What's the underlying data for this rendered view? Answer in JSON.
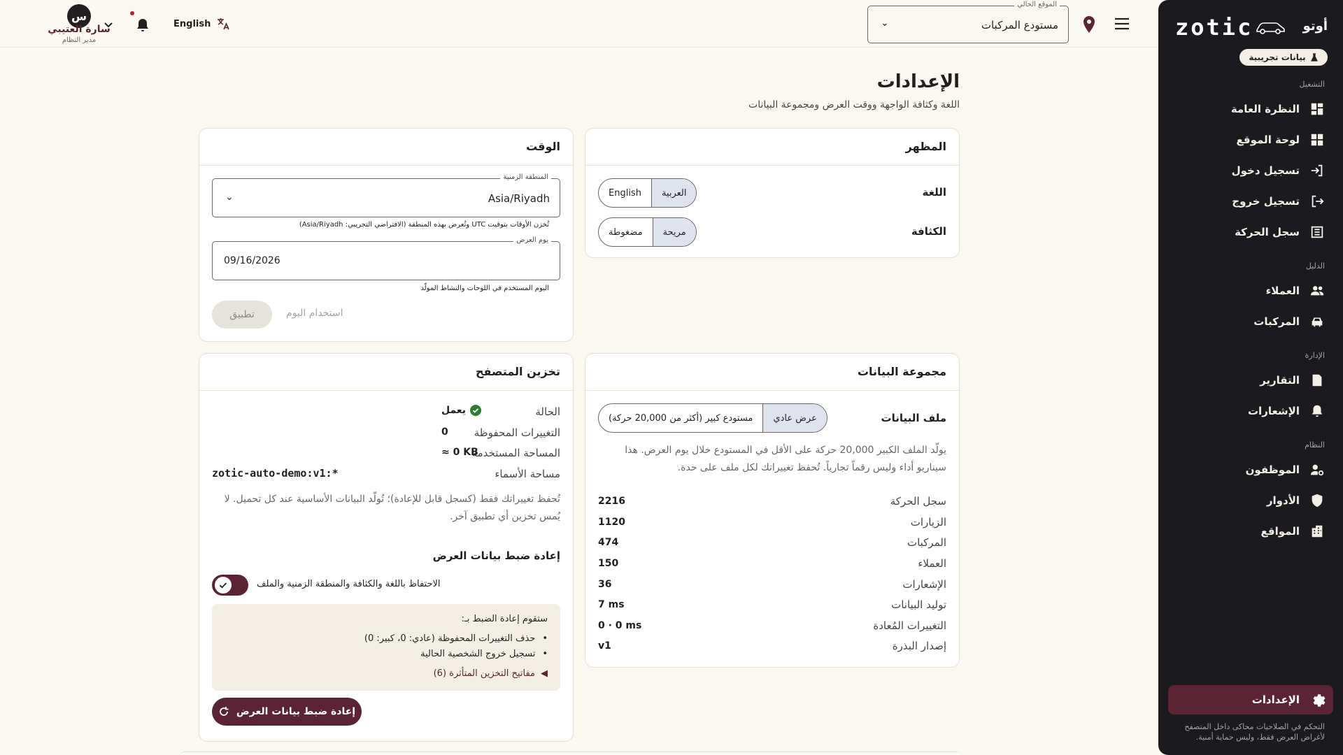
{
  "sidebar": {
    "brand_name": "أوتو",
    "logo_text": "zotic",
    "demo_badge": "بيانات تجريبية",
    "sections": {
      "operation": "التشغيل",
      "directory": "الدليل",
      "management": "الإدارة",
      "system": "النظام"
    },
    "items": [
      {
        "label": "النظرة العامة",
        "icon": "dashboard-icon"
      },
      {
        "label": "لوحة الموقع",
        "icon": "grid-icon"
      },
      {
        "label": "تسجيل دخول",
        "icon": "login-icon"
      },
      {
        "label": "تسجيل خروج",
        "icon": "logout-icon"
      },
      {
        "label": "سجل الحركة",
        "icon": "list-icon"
      },
      {
        "label": "العملاء",
        "icon": "people-icon"
      },
      {
        "label": "المركبات",
        "icon": "car-icon"
      },
      {
        "label": "التقارير",
        "icon": "report-icon"
      },
      {
        "label": "الإشعارات",
        "icon": "bell-icon"
      },
      {
        "label": "الموظفون",
        "icon": "staff-icon"
      },
      {
        "label": "الأدوار",
        "icon": "shield-icon"
      },
      {
        "label": "المواقع",
        "icon": "building-icon"
      }
    ],
    "settings_label": "الإعدادات",
    "note": "التحكم في الصلاحيات محاكى داخل المتصفح لأغراض العرض فقط، وليس حماية أمنية."
  },
  "topbar": {
    "location_label": "الموقع الحالي",
    "location_value": "مستودع المركبات",
    "language_button": "English",
    "user_initial": "س",
    "user_name": "سارة العتيبي",
    "user_role": "مدير النظام",
    "caret": "⌄"
  },
  "page": {
    "title": "الإعدادات",
    "subtitle": "اللغة وكثافة الواجهة ووقت العرض ومجموعة البيانات"
  },
  "appearance": {
    "title": "المظهر",
    "language_label": "اللغة",
    "language_options": [
      "العربية",
      "English"
    ],
    "density_label": "الكثافة",
    "density_options": [
      "مريحة",
      "مضغوطة"
    ]
  },
  "time": {
    "title": "الوقت",
    "timezone_label": "المنطقة الزمنية",
    "timezone_value": "Asia/Riyadh",
    "timezone_help": "تُخزن الأوقات بتوقيت UTC وتُعرض بهذه المنطقة (الافتراضي التجريبي: Asia/Riyadh)",
    "display_day_label": "يوم العرض",
    "display_day_value": "09/16/2026",
    "display_day_help": "اليوم المستخدم في اللوحات والنشاط المولّد",
    "apply_label": "تطبيق",
    "today_label": "استخدام اليوم"
  },
  "dataset": {
    "title": "مجموعة البيانات",
    "profile_label": "ملف البيانات",
    "profile_options": [
      "عرض عادي",
      "مستودع كبير (أكثر من 20,000 حركة)"
    ],
    "description": "يولّد الملف الكبير 20,000 حركة على الأقل في المستودع خلال يوم العرض. هذا سيناريو أداء وليس رقماً تجارياً. تُحفظ تغييراتك لكل ملف على حدة.",
    "stats": [
      {
        "label": "سجل الحركة",
        "value": "2216"
      },
      {
        "label": "الزيارات",
        "value": "1120"
      },
      {
        "label": "المركبات",
        "value": "474"
      },
      {
        "label": "العملاء",
        "value": "150"
      },
      {
        "label": "الإشعارات",
        "value": "36"
      },
      {
        "label": "توليد البيانات",
        "value": "7 ms"
      },
      {
        "label": "التغييرات المُعادة",
        "value": "0 · 0 ms"
      },
      {
        "label": "إصدار البذرة",
        "value": "v1"
      }
    ]
  },
  "storage": {
    "title": "تخزين المتصفح",
    "rows": [
      {
        "label": "الحالة",
        "value": "يعمل"
      },
      {
        "label": "التغييرات المحفوظة",
        "value": "0"
      },
      {
        "label": "المساحة المستخدمة",
        "value": "≈ 0 KB"
      },
      {
        "label": "مساحة الأسماء",
        "value": "zotic-auto-demo:v1:*"
      }
    ],
    "note": "تُحفظ تغييراتك فقط (كسجل قابل للإعادة)؛ تُولّد البيانات الأساسية عند كل تحميل. لا يُمس تخزين أي تطبيق آخر.",
    "reset_title": "إعادة ضبط بيانات العرض",
    "keep_toggle_label": "الاحتفاظ باللغة والكثافة والمنطقة الزمنية والملف",
    "reset_box_title": "ستقوم إعادة الضبط بـ:",
    "reset_items": [
      "حذف التغييرات المحفوظة (عادي: 0، كبير: 0)",
      "تسجيل خروج الشخصية الحالية"
    ],
    "affected_keys": "مفاتيح التخزين المتأثرة (6)",
    "reset_button": "إعادة ضبط بيانات العرض"
  },
  "colors": {
    "accent": "#5b2434",
    "sidebar_bg": "#1b1a1f",
    "page_bg": "#fbf8f1",
    "status_ok": "#2e7d32"
  }
}
